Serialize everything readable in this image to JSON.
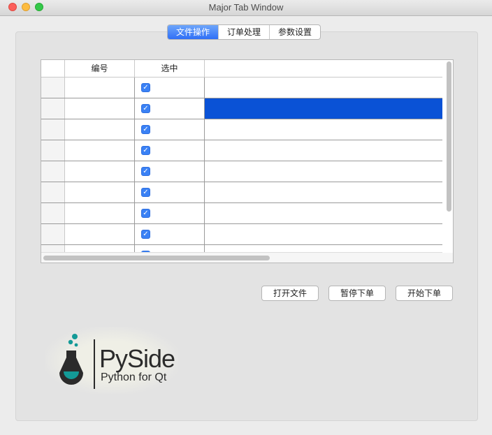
{
  "window": {
    "title": "Major Tab Window"
  },
  "tabs": [
    {
      "label": "文件操作",
      "active": true
    },
    {
      "label": "订单处理",
      "active": false
    },
    {
      "label": "参数设置",
      "active": false
    }
  ],
  "table": {
    "headers": [
      "",
      "编号",
      "选中",
      ""
    ],
    "rows": [
      {
        "number": "",
        "checked": true,
        "selected": false
      },
      {
        "number": "",
        "checked": true,
        "selected": true
      },
      {
        "number": "",
        "checked": true,
        "selected": false
      },
      {
        "number": "",
        "checked": true,
        "selected": false
      },
      {
        "number": "",
        "checked": true,
        "selected": false
      },
      {
        "number": "",
        "checked": true,
        "selected": false
      },
      {
        "number": "",
        "checked": true,
        "selected": false
      },
      {
        "number": "",
        "checked": true,
        "selected": false
      },
      {
        "number": "",
        "checked": true,
        "selected": false
      }
    ],
    "selection_color": "#0a52d6"
  },
  "buttons": {
    "open_file": "打开文件",
    "pause_order": "暂停下单",
    "start_order": "开始下单"
  },
  "logo": {
    "name": "PySide",
    "tagline": "Python for Qt",
    "accent": "#139a97"
  }
}
